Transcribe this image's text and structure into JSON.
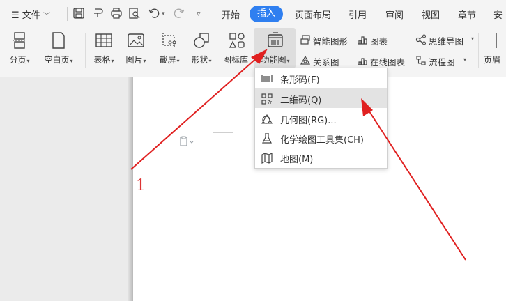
{
  "menubar": {
    "file_label": "文件",
    "tabs": [
      {
        "label": "开始"
      },
      {
        "label": "插入",
        "active": true
      },
      {
        "label": "页面布局"
      },
      {
        "label": "引用"
      },
      {
        "label": "审阅"
      },
      {
        "label": "视图"
      },
      {
        "label": "章节"
      },
      {
        "label": "安"
      }
    ]
  },
  "ribbon": {
    "big_buttons": [
      {
        "label": "分页",
        "icon": "page-break-icon"
      },
      {
        "label": "空白页",
        "icon": "blank-page-icon"
      },
      {
        "label": "表格",
        "icon": "table-icon"
      },
      {
        "label": "图片",
        "icon": "picture-icon"
      },
      {
        "label": "截屏",
        "icon": "screenshot-icon"
      },
      {
        "label": "形状",
        "icon": "shape-icon"
      },
      {
        "label": "图标库",
        "icon": "icon-library-icon"
      },
      {
        "label": "功能图",
        "icon": "function-chart-icon",
        "pressed": true
      }
    ],
    "small_buttons": [
      {
        "label": "智能图形",
        "icon": "smart-art-icon"
      },
      {
        "label": "图表",
        "icon": "chart-icon"
      },
      {
        "label": "思维导图",
        "icon": "mind-map-icon"
      },
      {
        "label": "关系图",
        "icon": "relation-chart-icon"
      },
      {
        "label": "在线图表",
        "icon": "online-chart-icon"
      },
      {
        "label": "流程图",
        "icon": "flowchart-icon"
      }
    ],
    "edge_label": "页眉"
  },
  "dropdown": {
    "items": [
      {
        "label": "条形码(F)",
        "icon": "barcode-icon"
      },
      {
        "label": "二维码(Q)",
        "icon": "qr-code-icon",
        "highlighted": true
      },
      {
        "label": "几何图(RG)...",
        "icon": "geometry-icon"
      },
      {
        "label": "化学绘图工具集(CH)",
        "icon": "chemistry-flask-icon"
      },
      {
        "label": "地图(M)",
        "icon": "map-icon"
      }
    ]
  },
  "annotation": {
    "step_number": "1",
    "color": "#d33333"
  },
  "colors": {
    "accent": "#2f7ff0",
    "arrow": "#e02020"
  }
}
